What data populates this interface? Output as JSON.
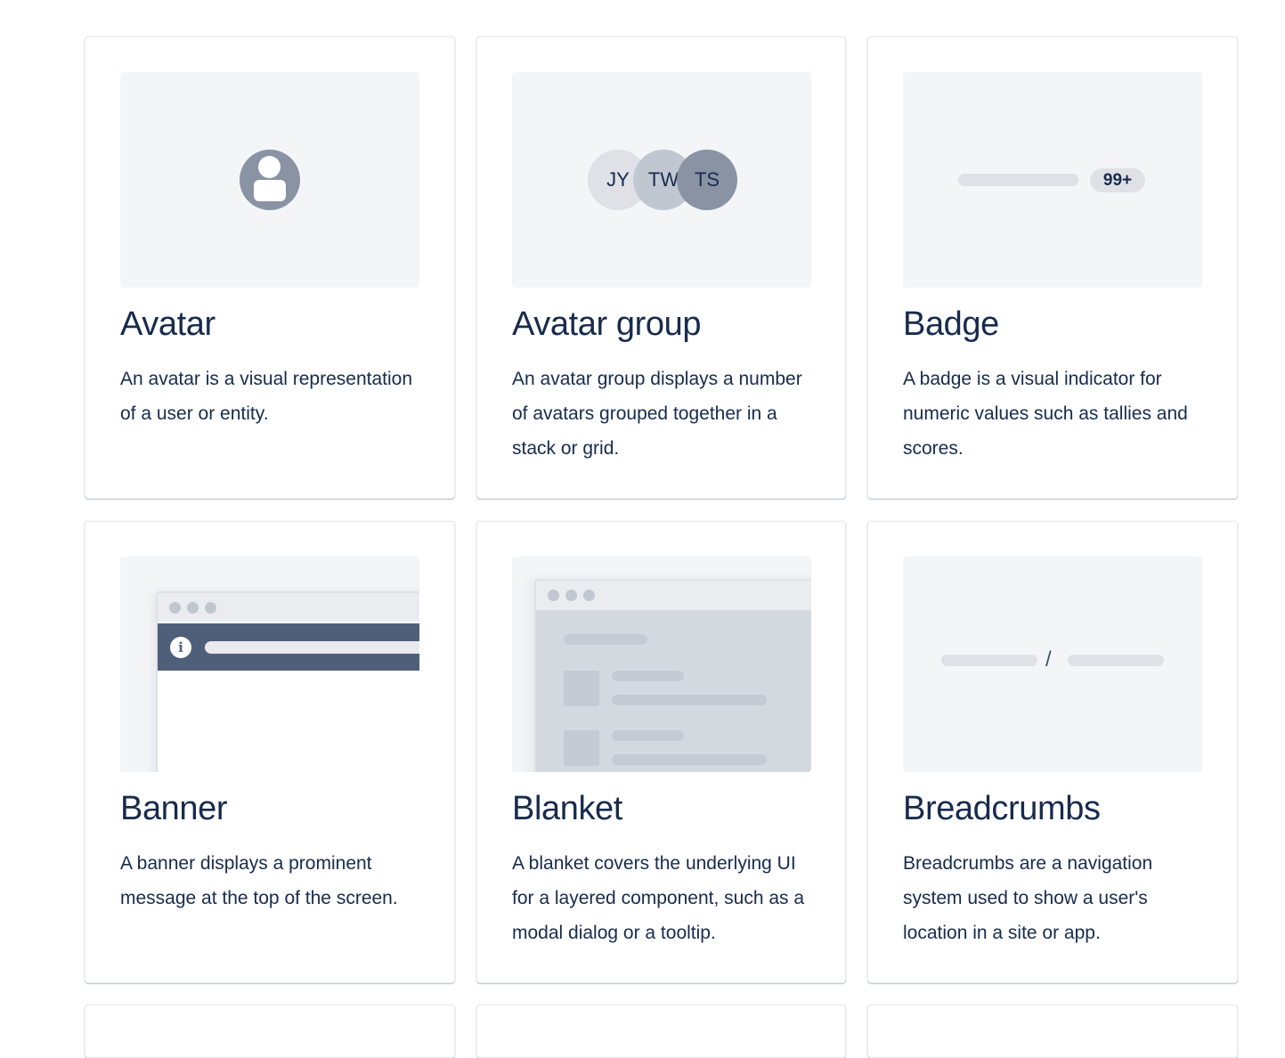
{
  "cards": [
    {
      "title": "Avatar",
      "description": "An avatar is a visual representation of a user or entity."
    },
    {
      "title": "Avatar group",
      "description": "An avatar group displays a number of avatars grouped together in a stack or grid.",
      "preview": {
        "initials": [
          "JY",
          "TW",
          "TS"
        ]
      }
    },
    {
      "title": "Badge",
      "description": "A badge is a visual indicator for numeric values such as tallies and scores.",
      "preview": {
        "badge_text": "99+"
      }
    },
    {
      "title": "Banner",
      "description": "A banner displays a prominent message at the top of the screen.",
      "preview": {
        "icon": "info-icon",
        "icon_glyph": "i"
      }
    },
    {
      "title": "Blanket",
      "description": "A blanket covers the underlying UI for a layered component, such as a modal dialog or a tooltip."
    },
    {
      "title": "Breadcrumbs",
      "description": "Breadcrumbs are a navigation system used to show a user's location in a site or app.",
      "preview": {
        "separator": "/"
      }
    }
  ],
  "colors": {
    "text": "#172b4d",
    "thumb_bg": "#f4f5f7",
    "avatar": "#8993a4",
    "banner": "#505f79"
  }
}
